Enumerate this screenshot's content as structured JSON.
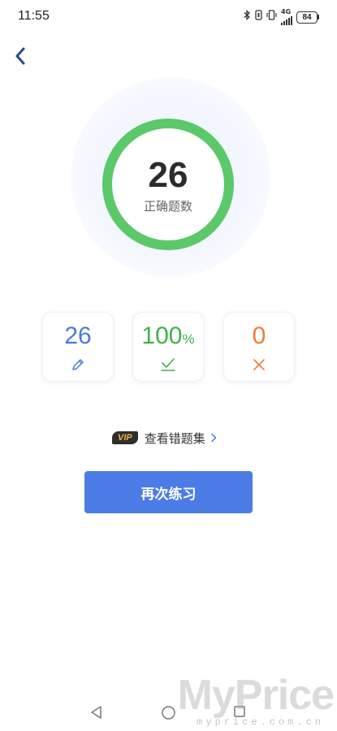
{
  "status_bar": {
    "time": "11:55",
    "network": "4G",
    "battery": "84"
  },
  "result": {
    "score": "26",
    "score_label": "正确题数",
    "ring_color": "#5bc86a"
  },
  "stats": [
    {
      "value": "26",
      "unit": "",
      "icon": "pencil-icon",
      "color": "#4a7bd8"
    },
    {
      "value": "100",
      "unit": "%",
      "icon": "check-icon",
      "color": "#3fb24d"
    },
    {
      "value": "0",
      "unit": "",
      "icon": "cross-icon",
      "color": "#ef7d3b"
    }
  ],
  "wrong_book": {
    "vip_badge": "VIP",
    "label": "查看错题集"
  },
  "actions": {
    "retry_label": "再次练习",
    "accent": "#4b7ce5"
  },
  "watermark": {
    "main": "MyPrice",
    "sub": "myprice.com.cn"
  }
}
